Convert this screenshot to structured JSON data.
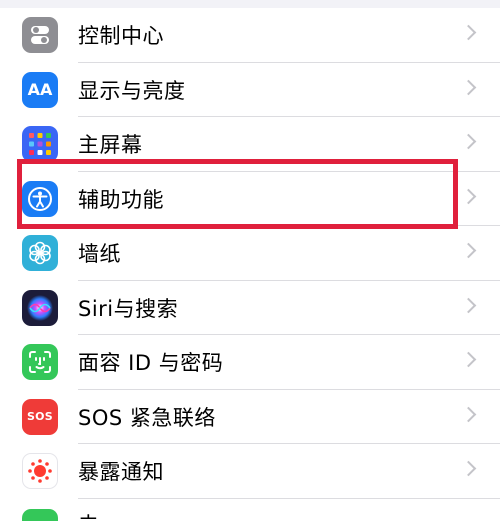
{
  "settings": {
    "items": [
      {
        "label": "控制中心",
        "icon": "control-center-icon",
        "color": "#8e8e93"
      },
      {
        "label": "显示与亮度",
        "icon": "display-brightness-icon",
        "color": "#1a7cf5",
        "glyph": "AA"
      },
      {
        "label": "主屏幕",
        "icon": "home-screen-icon",
        "color": "#3a66f5"
      },
      {
        "label": "辅助功能",
        "icon": "accessibility-icon",
        "color": "#1a7cf5"
      },
      {
        "label": "墙纸",
        "icon": "wallpaper-icon",
        "color": "#30b0d8"
      },
      {
        "label": "Siri与搜索",
        "icon": "siri-icon",
        "color": "#1c1c3a"
      },
      {
        "label": "面容 ID 与密码",
        "icon": "face-id-icon",
        "color": "#34c759"
      },
      {
        "label": "SOS 紧急联络",
        "icon": "sos-icon",
        "color": "#ef3b38",
        "glyph": "SOS"
      },
      {
        "label": "暴露通知",
        "icon": "exposure-notification-icon",
        "color": "#ffffff"
      }
    ],
    "partial_next_label": "电池"
  },
  "highlight": {
    "target": "辅助功能",
    "color": "#e0203c"
  }
}
